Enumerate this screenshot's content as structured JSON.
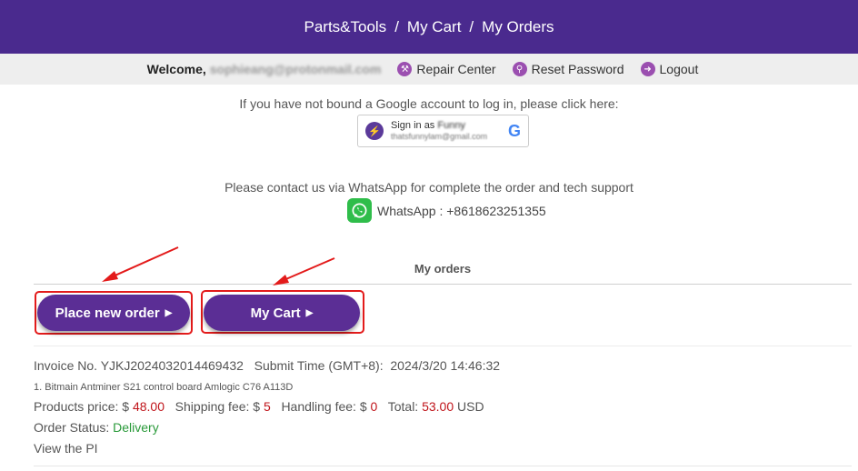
{
  "nav": {
    "parts_tools": "Parts&Tools",
    "my_cart": "My Cart",
    "my_orders": "My Orders",
    "separator": "/"
  },
  "userbar": {
    "welcome": "Welcome,",
    "email": "sophieang@protonmail.com",
    "repair_center": "Repair Center",
    "reset_password": "Reset Password",
    "logout": "Logout"
  },
  "google": {
    "note": "If you have not bound a Google account to log in, please click here:",
    "sign_in_as": "Sign in as",
    "name": "Funny",
    "email": "thatsfunnylam@gmail.com",
    "logo": "G"
  },
  "contact": {
    "note": "Please contact us via WhatsApp for complete the order and tech support",
    "whatsapp": "WhatsApp : +8618623251355"
  },
  "orders": {
    "title": "My orders",
    "place_new_order": "Place new order",
    "my_cart": "My Cart"
  },
  "order": {
    "invoice_label": "Invoice No.",
    "invoice_no": "YJKJ2024032014469432",
    "submit_label": "Submit Time (GMT+8):",
    "submit_time": "2024/3/20 14:46:32",
    "item": "1. Bitmain Antminer S21 control board Amlogic C76 A113D",
    "products_label": "Products price: $",
    "products_price": "48.00",
    "shipping_label": "Shipping fee: $",
    "shipping_fee": "5",
    "handling_label": "Handling fee: $",
    "handling_fee": "0",
    "total_label": "Total:",
    "total": "53.00",
    "currency": "USD",
    "status_label": "Order Status:",
    "status": "Delivery",
    "view_pi": "View the PI"
  },
  "colors": {
    "header": "#4a2a8e",
    "button": "#5b2e95",
    "highlight": "#e31b1b",
    "price": "#c0151b",
    "status": "#2a9a3a"
  },
  "icons": [
    "repair-icon",
    "key-icon",
    "logout-icon",
    "whatsapp-icon",
    "google-icon",
    "play-triangle-icon"
  ]
}
